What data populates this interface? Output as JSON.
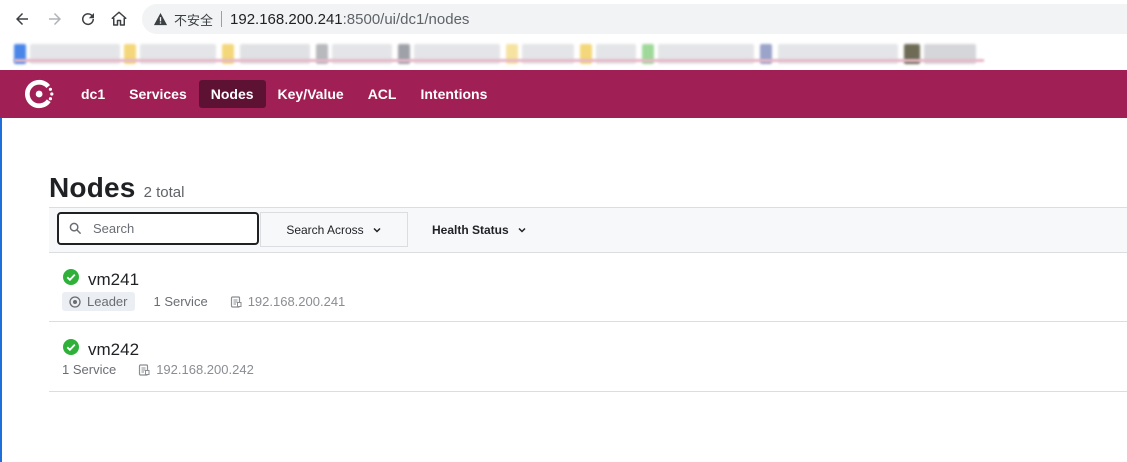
{
  "browser": {
    "security_label": "不安全",
    "url_host": "192.168.200.241",
    "url_path": ":8500/ui/dc1/nodes"
  },
  "header": {
    "datacenter": "dc1",
    "menu": [
      {
        "label": "Services",
        "active": false
      },
      {
        "label": "Nodes",
        "active": true
      },
      {
        "label": "Key/Value",
        "active": false
      },
      {
        "label": "ACL",
        "active": false
      },
      {
        "label": "Intentions",
        "active": false
      }
    ],
    "brand_color": "#a01f55",
    "active_color": "#5e1233"
  },
  "page": {
    "title": "Nodes",
    "count": "2 total"
  },
  "filters": {
    "search_placeholder": "Search",
    "search_across_label": "Search Across",
    "health_status_label": "Health Status"
  },
  "nodes": [
    {
      "name": "vm241",
      "status": "passing",
      "leader_label": "Leader",
      "services": "1 Service",
      "address": "192.168.200.241"
    },
    {
      "name": "vm242",
      "status": "passing",
      "services": "1 Service",
      "address": "192.168.200.242"
    }
  ],
  "colors": {
    "passing": "#2eb039"
  }
}
